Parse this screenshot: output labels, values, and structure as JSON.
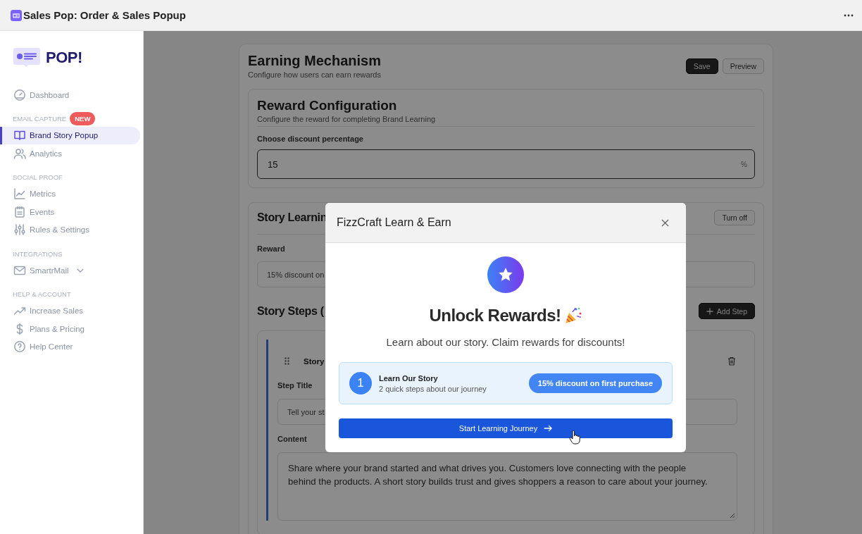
{
  "app_bar": {
    "title": "Sales Pop: Order & Sales Popup"
  },
  "sidebar": {
    "logo": "POP!",
    "sections": [
      {
        "items": [
          {
            "label": "Dashboard",
            "selected": false
          }
        ]
      },
      {
        "heading": "EMAIL CAPTURE",
        "badge": "NEW",
        "items": [
          {
            "label": "Brand Story Popup",
            "selected": true
          },
          {
            "label": "Analytics",
            "selected": false
          }
        ]
      },
      {
        "heading": "SOCIAL PROOF",
        "items": [
          {
            "label": "Metrics",
            "selected": false
          },
          {
            "label": "Events",
            "selected": false
          },
          {
            "label": "Rules & Settings",
            "selected": false
          }
        ]
      },
      {
        "heading": "INTEGRATIONS",
        "items": [
          {
            "label": "SmartrMail",
            "selected": false,
            "expanded": false
          }
        ]
      },
      {
        "heading": "HELP & ACCOUNT",
        "items": [
          {
            "label": "Increase Sales",
            "selected": false
          },
          {
            "label": "Plans & Pricing",
            "selected": false
          },
          {
            "label": "Help Center",
            "selected": false
          }
        ]
      }
    ]
  },
  "page": {
    "title": "Earning Mechanism",
    "subtitle": "Configure how users can earn rewards",
    "buttons": [
      {
        "label": "Save",
        "kind": "primary"
      },
      {
        "label": "Preview",
        "kind": "secondary"
      }
    ]
  },
  "reward_config": {
    "title": "Reward Configuration",
    "subtitle": "Configure the reward for completing Brand Learning",
    "field": {
      "label": "Choose discount percentage",
      "value": "15",
      "suffix": "%"
    }
  },
  "story_learning": {
    "title": "Story Learnin",
    "toggle_button": "Turn off",
    "reward_label": "Reward",
    "reward_value": "15% discount on",
    "steps_title": "Story Steps (",
    "add_button": "Add Step",
    "step": {
      "title": "Story",
      "fields": [
        {
          "label": "Step Title",
          "value": "Tell your st",
          "kind": "input"
        },
        {
          "label": "Content",
          "value": "Share where your brand started and what drives you. Customers love connecting with the people behind the products. A short story builds trust and gives shoppers a reason to care about your journey.",
          "kind": "textarea"
        }
      ]
    }
  },
  "modal": {
    "title": "FizzCraft Learn & Earn",
    "heading": "Unlock Rewards!",
    "subtitle": "Learn about our story. Claim rewards for discounts!",
    "offer": {
      "number": "1",
      "title": "Learn Our Story",
      "subtitle": "2 quick steps about our journey",
      "badge": "15% discount on first purchase"
    },
    "cta": "Start Learning Journey"
  }
}
